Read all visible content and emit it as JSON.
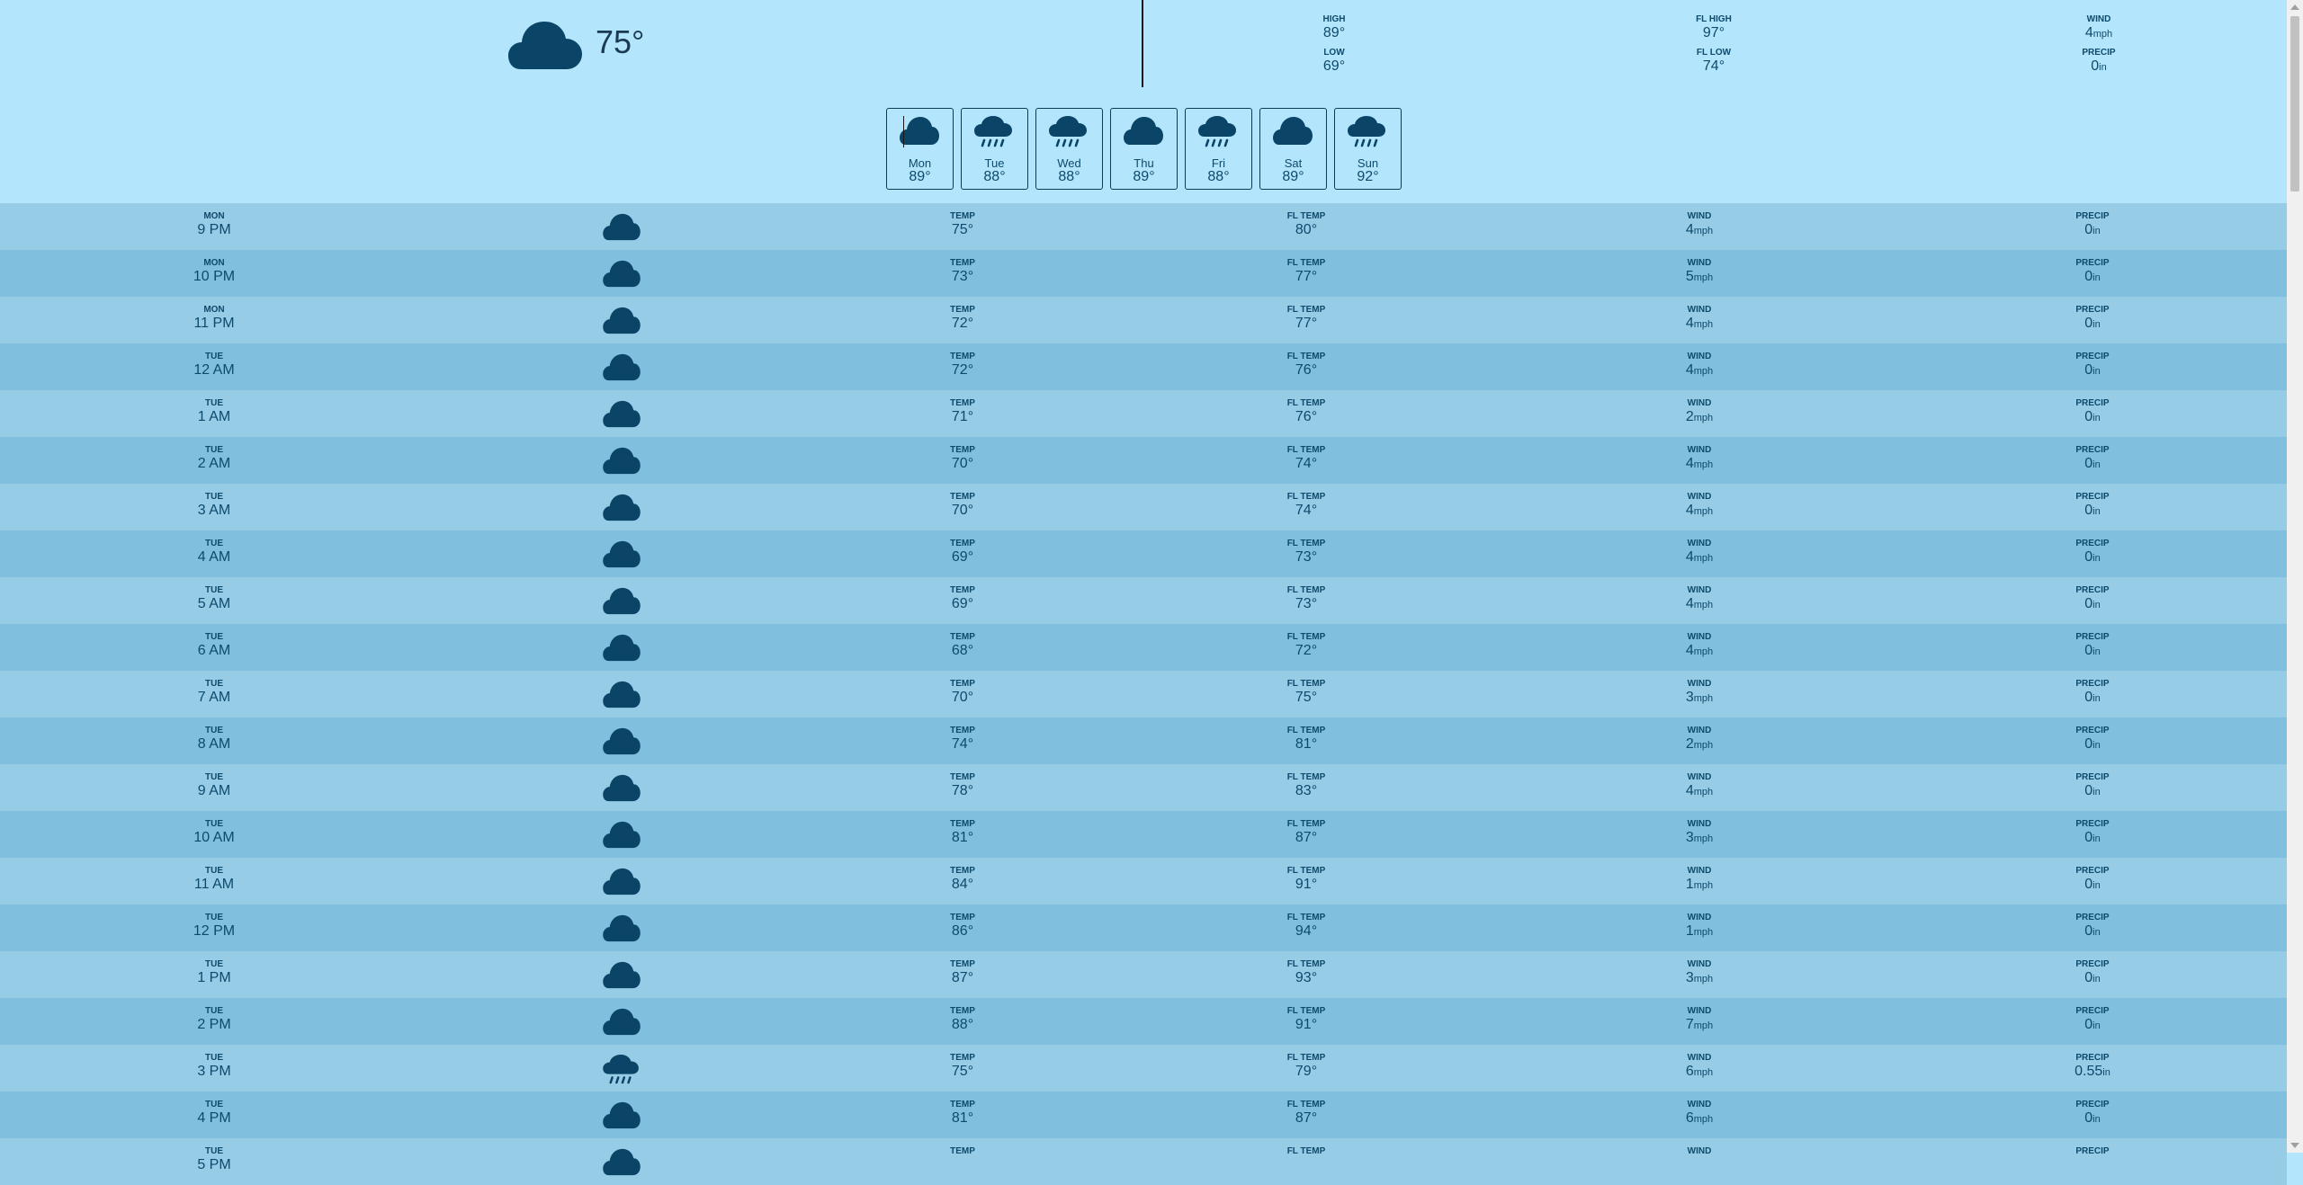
{
  "current": {
    "icon": "cloud-icon",
    "temp": "75°"
  },
  "stats": {
    "high": {
      "label": "HIGH",
      "value": "89°"
    },
    "low": {
      "label": "LOW",
      "value": "69°"
    },
    "fl_high": {
      "label": "FL HIGH",
      "value": "97°"
    },
    "fl_low": {
      "label": "FL LOW",
      "value": "74°"
    },
    "wind": {
      "label": "WIND",
      "value": "4",
      "unit": "mph"
    },
    "precip": {
      "label": "PRECIP",
      "value": "0",
      "unit": "in"
    }
  },
  "days": [
    {
      "name": "Mon",
      "temp": "89°",
      "icon": "cloud-icon"
    },
    {
      "name": "Tue",
      "temp": "88°",
      "icon": "rain-cloud-icon"
    },
    {
      "name": "Wed",
      "temp": "88°",
      "icon": "rain-cloud-icon"
    },
    {
      "name": "Thu",
      "temp": "89°",
      "icon": "cloud-icon"
    },
    {
      "name": "Fri",
      "temp": "88°",
      "icon": "rain-cloud-icon"
    },
    {
      "name": "Sat",
      "temp": "89°",
      "icon": "cloud-icon"
    },
    {
      "name": "Sun",
      "temp": "92°",
      "icon": "rain-cloud-icon"
    }
  ],
  "labels": {
    "temp": "TEMP",
    "fl_temp": "FL TEMP",
    "wind": "WIND",
    "precip": "PRECIP",
    "wind_unit": "mph",
    "precip_unit": "in"
  },
  "hours": [
    {
      "day": "MON",
      "time": "9 PM",
      "icon": "cloud-icon",
      "temp": "75°",
      "fl": "80°",
      "wind": "4",
      "precip": "0"
    },
    {
      "day": "MON",
      "time": "10 PM",
      "icon": "cloud-icon",
      "temp": "73°",
      "fl": "77°",
      "wind": "5",
      "precip": "0"
    },
    {
      "day": "MON",
      "time": "11 PM",
      "icon": "cloud-icon",
      "temp": "72°",
      "fl": "77°",
      "wind": "4",
      "precip": "0"
    },
    {
      "day": "TUE",
      "time": "12 AM",
      "icon": "cloud-icon",
      "temp": "72°",
      "fl": "76°",
      "wind": "4",
      "precip": "0"
    },
    {
      "day": "TUE",
      "time": "1 AM",
      "icon": "cloud-icon",
      "temp": "71°",
      "fl": "76°",
      "wind": "2",
      "precip": "0"
    },
    {
      "day": "TUE",
      "time": "2 AM",
      "icon": "cloud-icon",
      "temp": "70°",
      "fl": "74°",
      "wind": "4",
      "precip": "0"
    },
    {
      "day": "TUE",
      "time": "3 AM",
      "icon": "cloud-icon",
      "temp": "70°",
      "fl": "74°",
      "wind": "4",
      "precip": "0"
    },
    {
      "day": "TUE",
      "time": "4 AM",
      "icon": "cloud-icon",
      "temp": "69°",
      "fl": "73°",
      "wind": "4",
      "precip": "0"
    },
    {
      "day": "TUE",
      "time": "5 AM",
      "icon": "cloud-icon",
      "temp": "69°",
      "fl": "73°",
      "wind": "4",
      "precip": "0"
    },
    {
      "day": "TUE",
      "time": "6 AM",
      "icon": "cloud-icon",
      "temp": "68°",
      "fl": "72°",
      "wind": "4",
      "precip": "0"
    },
    {
      "day": "TUE",
      "time": "7 AM",
      "icon": "cloud-icon",
      "temp": "70°",
      "fl": "75°",
      "wind": "3",
      "precip": "0"
    },
    {
      "day": "TUE",
      "time": "8 AM",
      "icon": "cloud-icon",
      "temp": "74°",
      "fl": "81°",
      "wind": "2",
      "precip": "0"
    },
    {
      "day": "TUE",
      "time": "9 AM",
      "icon": "cloud-icon",
      "temp": "78°",
      "fl": "83°",
      "wind": "4",
      "precip": "0"
    },
    {
      "day": "TUE",
      "time": "10 AM",
      "icon": "cloud-icon",
      "temp": "81°",
      "fl": "87°",
      "wind": "3",
      "precip": "0"
    },
    {
      "day": "TUE",
      "time": "11 AM",
      "icon": "cloud-icon",
      "temp": "84°",
      "fl": "91°",
      "wind": "1",
      "precip": "0"
    },
    {
      "day": "TUE",
      "time": "12 PM",
      "icon": "cloud-icon",
      "temp": "86°",
      "fl": "94°",
      "wind": "1",
      "precip": "0"
    },
    {
      "day": "TUE",
      "time": "1 PM",
      "icon": "cloud-icon",
      "temp": "87°",
      "fl": "93°",
      "wind": "3",
      "precip": "0"
    },
    {
      "day": "TUE",
      "time": "2 PM",
      "icon": "cloud-icon",
      "temp": "88°",
      "fl": "91°",
      "wind": "7",
      "precip": "0"
    },
    {
      "day": "TUE",
      "time": "3 PM",
      "icon": "rain-cloud-icon",
      "temp": "75°",
      "fl": "79°",
      "wind": "6",
      "precip": "0.55"
    },
    {
      "day": "TUE",
      "time": "4 PM",
      "icon": "cloud-icon",
      "temp": "81°",
      "fl": "87°",
      "wind": "6",
      "precip": "0"
    },
    {
      "day": "TUE",
      "time": "5 PM",
      "icon": "cloud-icon",
      "temp": "",
      "fl": "",
      "wind": "",
      "precip": ""
    }
  ],
  "colors": {
    "bg": "#b3e5fc",
    "row_odd": "#97cce6",
    "row_even": "#80c0de",
    "icon": "#0a4466",
    "text": "#0d4a6b"
  }
}
